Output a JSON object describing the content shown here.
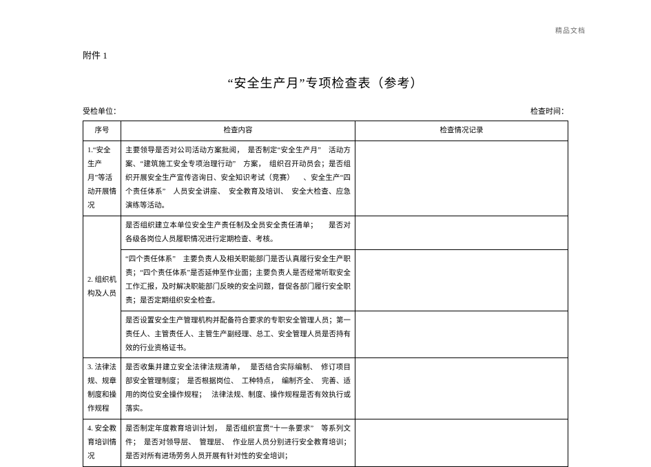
{
  "watermark": "精品文档",
  "attachment": "附件 1",
  "title": "“安全生产月”专项检查表（参考）",
  "meta": {
    "left": "受检单位：",
    "right": "检查时间："
  },
  "head": {
    "c1": "序号",
    "c2": "检查内容",
    "c3": "检查情况记录"
  },
  "rows": [
    {
      "idx": "1.“安全生产月”等活动开展情况",
      "contents": [
        "主要领导是否对公司活动方案批阅，　是否制定“安全生产月”　活动方案、“建筑施工安全专项治理行动”　方案，　组织召开动员会；是否组织开展安全生产宣传咨询日、安全知识考试（竞赛） 　、安全生产“四个责任体系”　人员安全讲座、　安全教育及培训、　安全大检查、应急演练等活动。"
      ]
    },
    {
      "idx": "2. 组织机构及人员",
      "contents": [
        "是否组织建立本单位安全生产责任制及全员安全责任清单；　　是否对各级各岗位人员履职情况进行定期检查、考核。",
        "“四个责任体系”　主要负责人及相关职能部门是否认真履行安全生产职责；“四个责任体系”是否延伸至作业面；主要负责人是否经常听取安全工作汇报，及时解决职能部门反映的安全问题，督促各部门履行安全职责；是否定期组织安全检查。",
        "是否设置安全生产管理机构并配备符合要求的专职安全管理人员；第一责任人、主管责任人、主管生产副经理、总工、安全管理人员是否持有效的行业资格证书。"
      ]
    },
    {
      "idx": "3. 法律法规、规章制度和操作规程",
      "contents": [
        "是否收集并建立安全法律法规清单，　 是否结合实际编制、　修订项目部安全管理制度；　是否根据岗位、　工种特点，　编制齐全、　完善、适用的岗位安全操作规程；　 法律法规、制度、操作规程是否有效执行或落实。"
      ]
    },
    {
      "idx": "4. 安全教育培训情况",
      "contents": [
        "是否制定年度教育培训计划，　是否组织宣贯“十一条要求”　等系列文件；　是否对领导层、　管理层、　作业层人员分别进行安全教育培训；是否对所有进场劳务人员开展有针对性的安全培训；"
      ]
    }
  ]
}
